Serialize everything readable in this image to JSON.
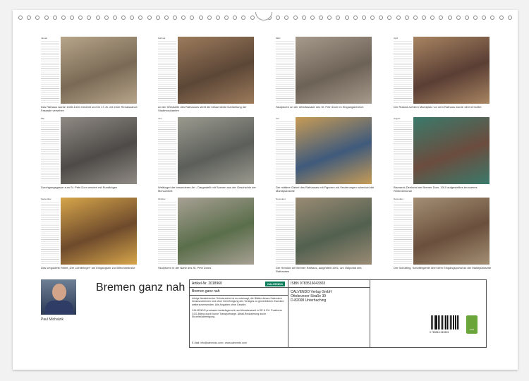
{
  "months": [
    {
      "name": "Januar",
      "caption": "Das Rathaus wurde 1405-1410 errichtet und im 17.Jh. mit einer Renaissance Fassade versehen"
    },
    {
      "name": "Februar",
      "caption": "An der Westseite des Rathauses steht die bekannteste Darstellung der Stadtmusikanten"
    },
    {
      "name": "März",
      "caption": "Skulpturen an der Westfassade des St. Petri Dom im Eingangsbereich"
    },
    {
      "name": "April",
      "caption": "Der Roland auf dem Marktplatz vor dem Rathaus wurde 1404 errichtet"
    },
    {
      "name": "Mai",
      "caption": "Durchgangsgasse zum St. Petri Dom verziert mit Rundbögen"
    },
    {
      "name": "Juni",
      "caption": "Weltkugel der besonderen Art - Dargestellt mit Szenen aus der Geschichte der Menschheit"
    },
    {
      "name": "Juli",
      "caption": "Der mittlere Giebel des Rathauses mit Figuren und Verzierungen schmückt die Marktplatzseite"
    },
    {
      "name": "August",
      "caption": "Bismarck-Denkmal am Bremer Dom, 1910 aufgestelltes bronzenes Reiterdenkmal"
    },
    {
      "name": "September",
      "caption": "Das vergoldete Relief „Der Lichtbringer“ am Eingangstor zur Böttcherstraße"
    },
    {
      "name": "Oktober",
      "caption": "Skulpturen in der Nähe des St. Petri Doms"
    },
    {
      "name": "November",
      "caption": "Der Herolde am Bremer Rathaus, aufgestellt 1901, am Ostportal des Rathauses"
    },
    {
      "name": "Dezember",
      "caption": "Der Schütting, Schaffergiebel über dem Eingangsportal an der Marktplatzseite"
    }
  ],
  "author": "Paul Michalzik",
  "title": "Bremen ganz nah",
  "info": {
    "article": "Artikel-Nr. 2018960",
    "logo": "CALVENDO",
    "product_title": "Bremen ganz nah",
    "legal": "Infolge feststehender Schutzrechte ist es untersagt, die Blätter dieses Kalenders herauszutrennen und ohne Genehmigung des Verlages zu gewerblichen Zwecken weiterzuverwenden. Alle Angaben ohne Gewähr.",
    "legal2": "CALVENDO produziert bedarfsgerecht und klimabewusst in DE & EU. Positivere CO2-Bilanz durch kurze Transportwege. Abfall-Reduzierung durch Einzelstückfertigung.",
    "contact": "E-Mail: info@calvendo.com • www.calvendo.com",
    "isbn": "ISBN 9783516043303",
    "publisher": [
      "CALVENDO Verlag GmbH",
      "Ottobrunner Straße 39",
      "D-82008 Unterhaching"
    ],
    "barcode_number": "9 783516 043303",
    "eco_label": "CO2"
  }
}
